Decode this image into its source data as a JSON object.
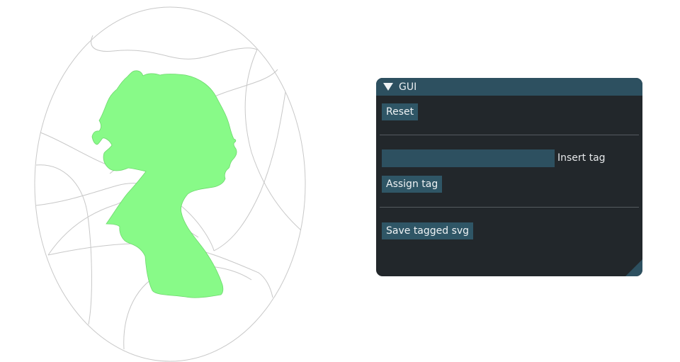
{
  "colors": {
    "silhouette_fill": "#88fa88",
    "line_stroke": "#c8c8c8",
    "panel_bg": "#22272b",
    "panel_accent": "#2f5666"
  },
  "gui": {
    "title": "GUI",
    "reset_label": "Reset",
    "tag_input_value": "",
    "tag_input_label": "Insert tag",
    "assign_label": "Assign tag",
    "save_label": "Save tagged svg"
  }
}
